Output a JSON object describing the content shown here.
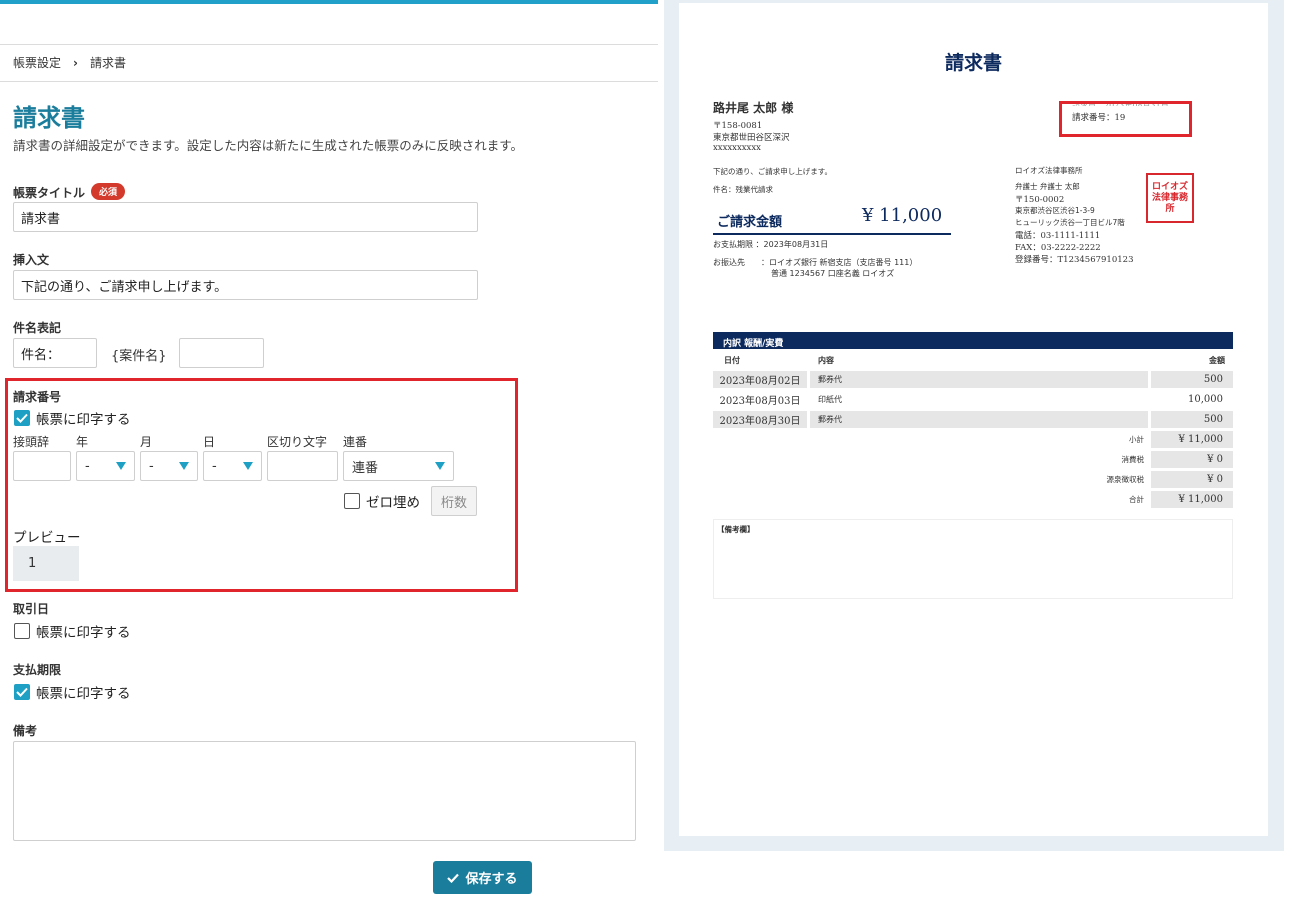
{
  "breadcrumb": {
    "parent": "帳票設定",
    "separator": "›",
    "current": "請求書"
  },
  "page": {
    "title": "請求書",
    "description": "請求書の詳細設定ができます。設定した内容は新たに生成された帳票のみに反映されます。"
  },
  "form": {
    "doc_title": {
      "label": "帳票タイトル",
      "badge": "必須",
      "value": "請求書"
    },
    "insert_text": {
      "label": "挿入文",
      "value": "下記の通り、ご請求申し上げます。"
    },
    "subject": {
      "label": "件名表記",
      "prefix_value": "件名：",
      "placeholder_text": "{案件名}",
      "suffix_value": ""
    },
    "invoice_number": {
      "label": "請求番号",
      "print_label": "帳票に印字する",
      "print_checked": true,
      "cols": {
        "prefix": "接頭辞",
        "year": "年",
        "month": "月",
        "day": "日",
        "delimiter": "区切り文字",
        "serial": "連番"
      },
      "values": {
        "prefix": "",
        "year": "-",
        "month": "-",
        "day": "-",
        "delimiter": "",
        "serial": "連番"
      },
      "zero_pad_label": "ゼロ埋め",
      "zero_pad_checked": false,
      "digits_placeholder": "桁数",
      "preview_label": "プレビュー",
      "preview_value": "1"
    },
    "trade_date": {
      "label": "取引日",
      "print_label": "帳票に印字する",
      "checked": false
    },
    "due_date": {
      "label": "支払期限",
      "print_label": "帳票に印字する",
      "checked": true
    },
    "notes": {
      "label": "備考",
      "value": ""
    },
    "save_label": "保存する"
  },
  "preview": {
    "title": "請求書",
    "recipient": "路井尾 太郎 様",
    "postal": "〒158-0081",
    "address": "東京都世田谷区深沢",
    "address2": "xxxxxxxxxx",
    "issue_date_label": "請求日",
    "issue_date_value": "2023年08月31日",
    "invoice_number_text": "請求番号：19",
    "greeting": "下記の通り、ご請求申し上げます。",
    "subject": "件名：残業代請求",
    "amount_label": "ご請求金額",
    "amount_value": "¥ 11,000",
    "due": "お支払期限 ：2023年08月31日",
    "bank_label": "お振込先",
    "bank_line1": "：ロイオズ銀行 新宿支店（支店番号 111）",
    "bank_line2": "普通 1234567  口座名義 ロイオズ",
    "firm": {
      "name": "ロイオズ法律事務所",
      "lawyer": "弁護士  弁護士 太郎",
      "postal": "〒150-0002",
      "addr1": "東京都渋谷区渋谷1-3-9",
      "addr2": "ヒューリック渋谷一丁目ビル7階",
      "tel": "電話：03-1111-1111",
      "fax": "FAX：03-2222-2222",
      "reg": "登録番号：T1234567910123"
    },
    "seal_text": "ロイオズ法律事務所",
    "table": {
      "title": "内訳 報酬/実費",
      "headers": {
        "date": "日付",
        "content": "内容",
        "amount": "金額"
      },
      "rows": [
        {
          "date": "2023年08月02日",
          "content": "郵券代",
          "amount": "500"
        },
        {
          "date": "2023年08月03日",
          "content": "印紙代",
          "amount": "10,000"
        },
        {
          "date": "2023年08月30日",
          "content": "郵券代",
          "amount": "500"
        }
      ],
      "totals": [
        {
          "label": "小計",
          "value": "¥ 11,000"
        },
        {
          "label": "消費税",
          "value": "¥ 0"
        },
        {
          "label": "源泉徴収税",
          "value": "¥ 0"
        },
        {
          "label": "合計",
          "value": "¥ 11,000"
        }
      ]
    },
    "notes_title": "【備考欄】"
  },
  "colors": {
    "accent": "#1b7d9c",
    "checkbox": "#1ea0c4",
    "highlight": "#e0262c",
    "navy": "#0d2a5e"
  }
}
